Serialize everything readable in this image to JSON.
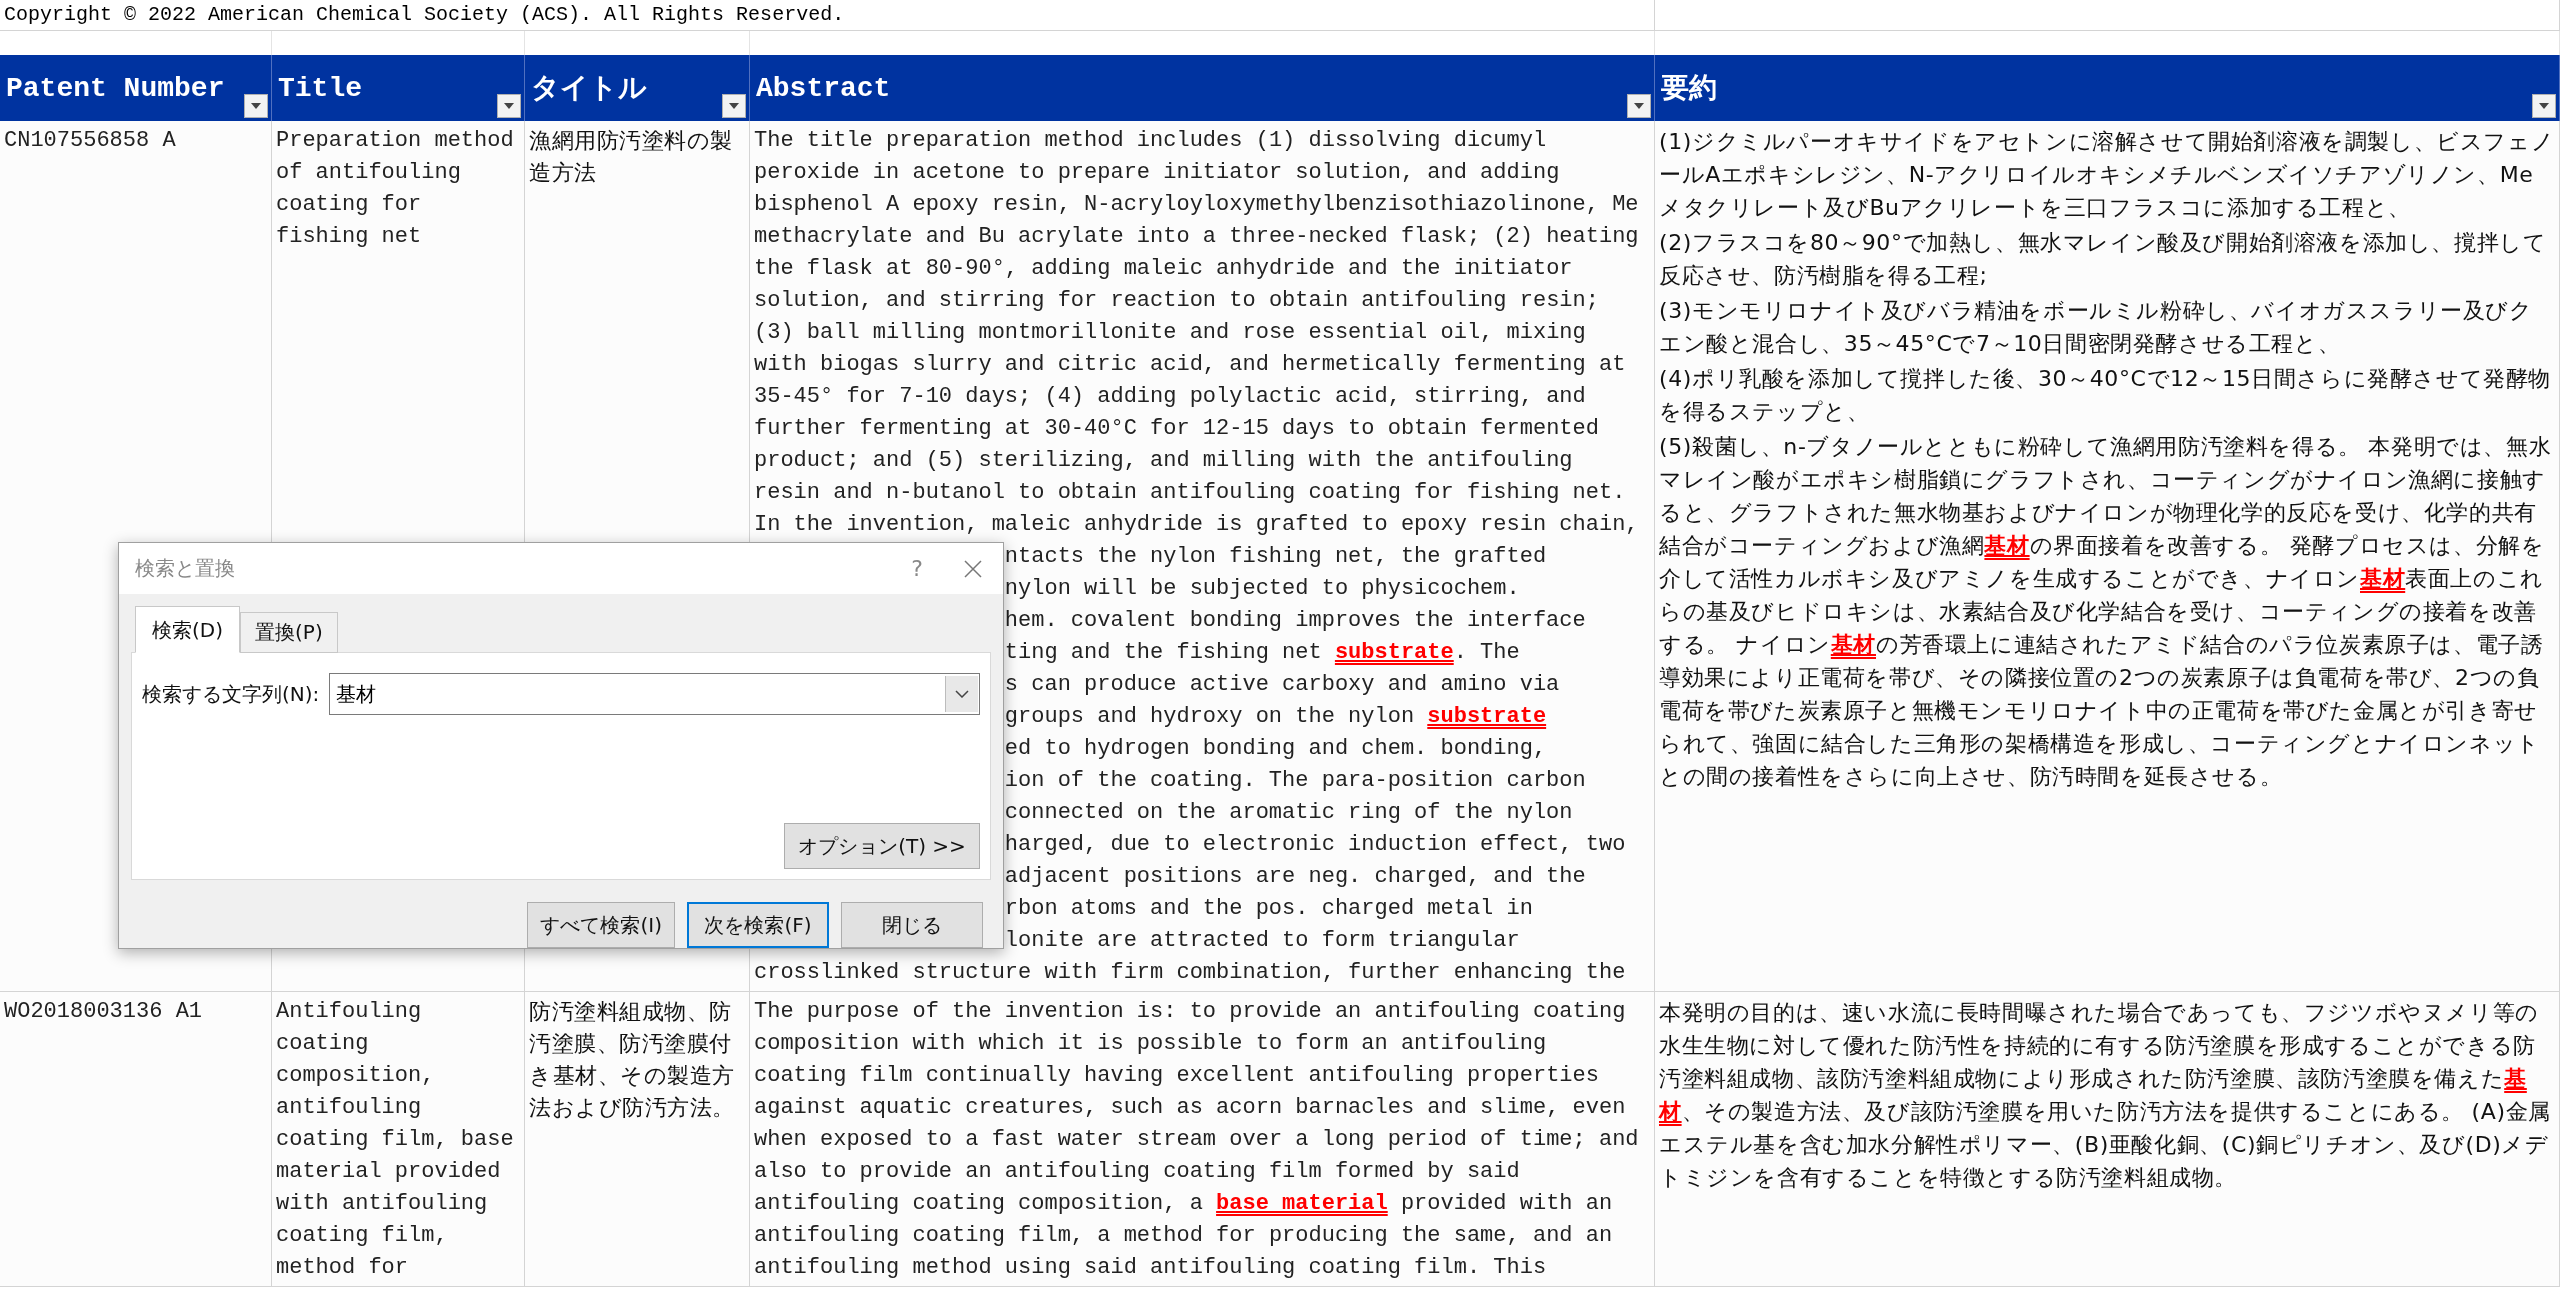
{
  "copyright": "Copyright © 2022 American Chemical Society (ACS). All Rights Reserved.",
  "columns": [
    "Patent Number",
    "Title",
    "タイトル",
    "Abstract",
    "要約"
  ],
  "rows": [
    {
      "patent_number": "CN107556858 A",
      "title": [
        "Preparation method",
        "of antifouling",
        "coating for",
        "fishing net"
      ],
      "title_ja": [
        "漁網用防汚塗料の製",
        "造方法"
      ],
      "abstract": [
        {
          "text": "The title preparation method includes (1) dissolving dicumyl",
          "covered": false
        },
        {
          "text": "peroxide in acetone to prepare initiator solution, and adding",
          "covered": false
        },
        {
          "text": "bisphenol A epoxy resin, N-acryloyloxymethylbenzisothiazolinone, Me",
          "covered": false
        },
        {
          "text": "methacrylate and Bu acrylate into a three-necked flask; (2) heating",
          "covered": false
        },
        {
          "text": "the flask at 80-90°, adding maleic anhydride and the initiator",
          "covered": false
        },
        {
          "text": "solution, and stirring for reaction to obtain antifouling resin;",
          "covered": false
        },
        {
          "text": "(3) ball milling montmorillonite and rose essential oil, mixing",
          "covered": false
        },
        {
          "text": "with biogas slurry and citric acid, and hermetically fermenting at",
          "covered": false
        },
        {
          "text": "35-45° for 7-10 days; (4) adding polylactic acid, stirring, and",
          "covered": false
        },
        {
          "text": "further fermenting at 30-40°C for 12-15 days to obtain fermented",
          "covered": false
        },
        {
          "text": "product; and (5) sterilizing, and milling with the antifouling",
          "covered": false
        },
        {
          "text": "resin and n-butanol to obtain antifouling coating for fishing net.",
          "covered": false
        },
        {
          "text": "In the invention, maleic anhydride is grafted to epoxy resin chain,",
          "covered": false
        },
        {
          "text": "ntacts the nylon fishing net, the grafted",
          "covered": true
        },
        {
          "text": "nylon will be subjected to physicochem.",
          "covered": true
        },
        {
          "text": "hem. covalent bonding improves the interface",
          "covered": true
        },
        {
          "text": "ting and the fishing net **substrate**. The",
          "covered": true
        },
        {
          "text": "s can produce active carboxy and amino via",
          "covered": true
        },
        {
          "text": "groups and hydroxy on the nylon **substrate**",
          "covered": true
        },
        {
          "text": "ed to hydrogen bonding and chem. bonding,",
          "covered": true
        },
        {
          "text": "ion of the coating. The para-position carbon",
          "covered": true
        },
        {
          "text": "connected on the aromatic ring of the nylon",
          "covered": true
        },
        {
          "text": "harged, due to electronic induction effect, two",
          "covered": true
        },
        {
          "text": "adjacent positions are neg. charged, and the",
          "covered": true
        },
        {
          "text": "rbon atoms and the pos. charged metal in",
          "covered": true
        },
        {
          "text": "lonite are attracted to form triangular",
          "covered": true
        },
        {
          "text": "crosslinked structure with firm combination, further enhancing the",
          "covered": false
        }
      ],
      "abstract_ja": [
        "(1)ジクミルパーオキサイドをアセトンに溶解させて開始剤溶液を調製し、ビスフェノールAエポキシレジン、N-アクリロイルオキシメチルベンズイソチアゾリノン、Meメタクリレート及びBuアクリレートを三口フラスコに添加する工程と、",
        "(2)フラスコを80～90°で加熱し、無水マレイン酸及び開始剤溶液を添加し、撹拌して反応させ、防汚樹脂を得る工程;",
        "(3)モンモリロナイト及びバラ精油をボールミル粉砕し、バイオガススラリー及びクエン酸と混合し、35～45°Cで7～10日間密閉発酵させる工程と、",
        "(4)ポリ乳酸を添加して撹拌した後、30～40°Cで12～15日間さらに発酵させて発酵物を得るステップと、",
        "(5)殺菌し、n-ブタノールとともに粉砕して漁網用防汚塗料を得る。 本発明では、無水マレイン酸がエポキシ樹脂鎖にグラフトされ、コーティングがナイロン漁網に接触すると、グラフトされた無水物基およびナイロンが物理化学的反応を受け、化学的共有結合がコーティングおよび漁網**基材**の界面接着を改善する。 発酵プロセスは、分解を介して活性カルボキシ及びアミノを生成することができ、ナイロン**基材**表面上のこれらの基及びヒドロキシは、水素結合及び化学結合を受け、コーティングの接着を改善する。 ナイロン**基材**の芳香環上に連結されたアミド結合のパラ位炭素原子は、電子誘導効果により正電荷を帯び、その隣接位置の2つの炭素原子は負電荷を帯び、2つの負電荷を帯びた炭素原子と無機モンモリロナイト中の正電荷を帯びた金属とが引き寄せられて、強固に結合した三角形の架橋構造を形成し、コーティングとナイロンネットとの間の接着性をさらに向上させ、防汚時間を延長させる。"
      ]
    },
    {
      "patent_number": "WO2018003136 A1",
      "title": [
        "Antifouling",
        "coating",
        "composition,",
        "antifouling",
        "coating film, base",
        "material provided",
        "with antifouling",
        "coating film,",
        "method for"
      ],
      "title_ja": [
        "防汚塗料組成物、防",
        "汚塗膜、防汚塗膜付",
        "き基材、その製造方",
        "法および防汚方法。"
      ],
      "abstract": [
        {
          "text": "The purpose of the invention is: to provide an antifouling coating",
          "covered": false
        },
        {
          "text": "composition with which it is possible to form an antifouling",
          "covered": false
        },
        {
          "text": "coating film continually having excellent antifouling properties",
          "covered": false
        },
        {
          "text": "against aquatic creatures, such as acorn barnacles and slime, even",
          "covered": false
        },
        {
          "text": "when exposed to a fast water stream over a long period of time; and",
          "covered": false
        },
        {
          "text": "also to provide an antifouling coating film formed by said",
          "covered": false
        },
        {
          "text": "antifouling coating composition, a **base material** provided with an",
          "covered": false
        },
        {
          "text": "antifouling coating film, a method for producing the same, and an",
          "covered": false
        },
        {
          "text": "antifouling method using said antifouling coating film. This",
          "covered": false
        }
      ],
      "abstract_ja": [
        "本発明の目的は、速い水流に長時間曝された場合であっても、フジツボやヌメリ等の水生生物に対して優れた防汚性を持続的に有する防汚塗膜を形成することができる防汚塗料組成物、該防汚塗料組成物により形成された防汚塗膜、該防汚塗膜を備えた**基材**、その製造方法、及び該防汚塗膜を用いた防汚方法を提供することにある。 (A)金属エステル基を含む加水分解性ポリマー、(B)亜酸化銅、(C)銅ピリチオン、及び(D)メデトミジンを含有することを特徴とする防汚塗料組成物。"
      ]
    }
  ],
  "dialog": {
    "title": "検索と置換",
    "help": "?",
    "tabs": [
      {
        "label": "検索(D)",
        "selected": true
      },
      {
        "label": "置換(P)",
        "selected": false
      }
    ],
    "search_label": "検索する文字列(N):",
    "search_value": "基材",
    "options_button": "オプション(T) >>",
    "buttons": [
      {
        "label": "すべて検索(I)",
        "default": false
      },
      {
        "label": "次を検索(F)",
        "default": true
      },
      {
        "label": "閉じる",
        "default": false
      }
    ]
  }
}
